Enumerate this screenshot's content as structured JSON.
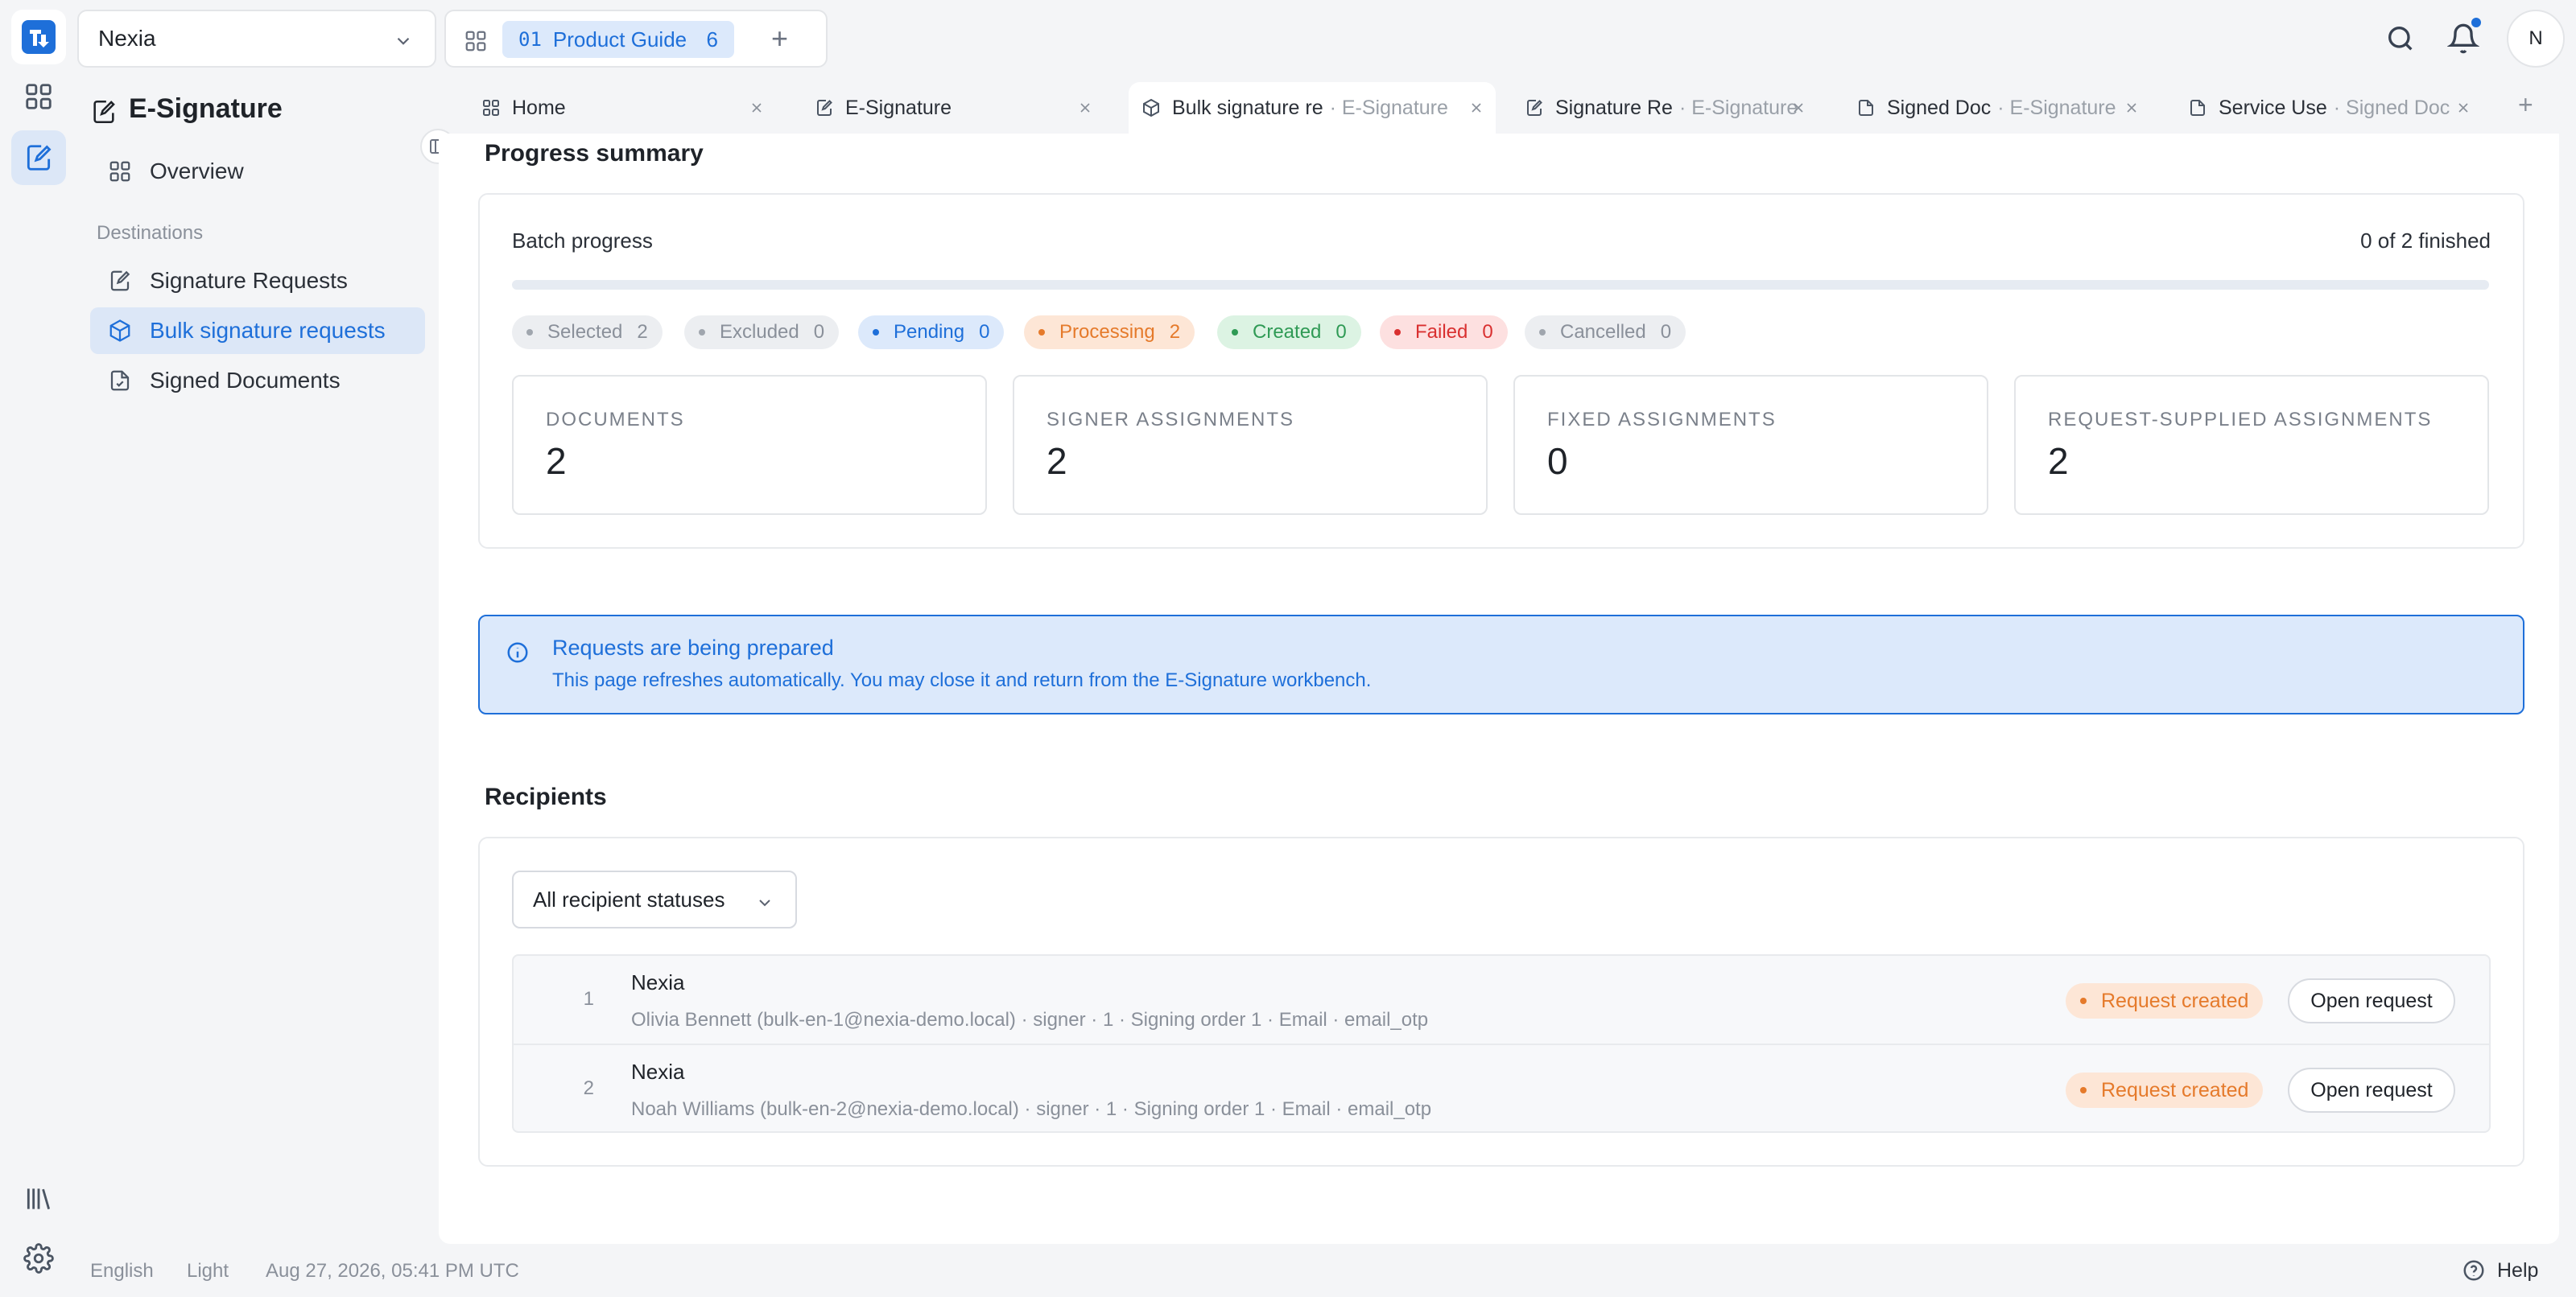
{
  "workspace": {
    "name": "Nexia"
  },
  "guide": {
    "number": "01",
    "label": "Product Guide",
    "count": "6"
  },
  "user": {
    "initial": "N"
  },
  "colors": {
    "accent": "#1e6fd9",
    "accent_bg": "#dce7f7",
    "warning": "#e57a2b"
  },
  "sidebar": {
    "title": "E-Signature",
    "overview": "Overview",
    "section": "Destinations",
    "items": [
      {
        "label": "Signature Requests",
        "icon": "document-edit-icon"
      },
      {
        "label": "Bulk signature requests",
        "icon": "package-icon"
      },
      {
        "label": "Signed Documents",
        "icon": "document-check-icon"
      }
    ]
  },
  "tabs": [
    {
      "label": "Home",
      "sub": ""
    },
    {
      "label": "E-Signature",
      "sub": ""
    },
    {
      "label": "Bulk signature re",
      "sub": "· E-Signature"
    },
    {
      "label": "Signature Re",
      "sub": "· E-Signature"
    },
    {
      "label": "Signed Doc",
      "sub": "· E-Signature"
    },
    {
      "label": "Service Use",
      "sub": "· Signed Doc"
    }
  ],
  "progress": {
    "heading": "Progress summary",
    "batch_label": "Batch progress",
    "finished": "0 of 2 finished",
    "fraction": 0
  },
  "chips": [
    {
      "label": "Selected",
      "count": "2",
      "bg": "#eceef1",
      "fg": "#8a909a",
      "dot": "#a0a6ae"
    },
    {
      "label": "Excluded",
      "count": "0",
      "bg": "#eceef1",
      "fg": "#8a909a",
      "dot": "#a0a6ae"
    },
    {
      "label": "Pending",
      "count": "0",
      "bg": "#dce9fb",
      "fg": "#1e6fd9",
      "dot": "#1e6fd9"
    },
    {
      "label": "Processing",
      "count": "2",
      "bg": "#fde6d6",
      "fg": "#e57a2b",
      "dot": "#e57a2b"
    },
    {
      "label": "Created",
      "count": "0",
      "bg": "#dcf3e3",
      "fg": "#2f9a55",
      "dot": "#2f9a55"
    },
    {
      "label": "Failed",
      "count": "0",
      "bg": "#fde0e0",
      "fg": "#d93030",
      "dot": "#d93030"
    },
    {
      "label": "Cancelled",
      "count": "0",
      "bg": "#eceef1",
      "fg": "#8a909a",
      "dot": "#a0a6ae"
    }
  ],
  "stats": [
    {
      "label": "DOCUMENTS",
      "value": "2"
    },
    {
      "label": "SIGNER ASSIGNMENTS",
      "value": "2"
    },
    {
      "label": "FIXED ASSIGNMENTS",
      "value": "0"
    },
    {
      "label": "REQUEST-SUPPLIED ASSIGNMENTS",
      "value": "2"
    }
  ],
  "banner": {
    "title": "Requests are being prepared",
    "body": "This page refreshes automatically. You may close it and return from the E-Signature workbench."
  },
  "recipients": {
    "heading": "Recipients",
    "filter": "All recipient statuses",
    "rows": [
      {
        "index": "1",
        "name": "Nexia",
        "meta": "Olivia Bennett (bulk-en-1@nexia-demo.local) · signer · 1 · Signing order 1 · Email · email_otp",
        "status": "Request created",
        "action": "Open request"
      },
      {
        "index": "2",
        "name": "Nexia",
        "meta": "Noah Williams (bulk-en-2@nexia-demo.local) · signer · 1 · Signing order 1 · Email · email_otp",
        "status": "Request created",
        "action": "Open request"
      }
    ]
  },
  "footer": {
    "language": "English",
    "theme": "Light",
    "datetime": "Aug 27, 2026, 05:41 PM UTC",
    "help": "Help"
  }
}
